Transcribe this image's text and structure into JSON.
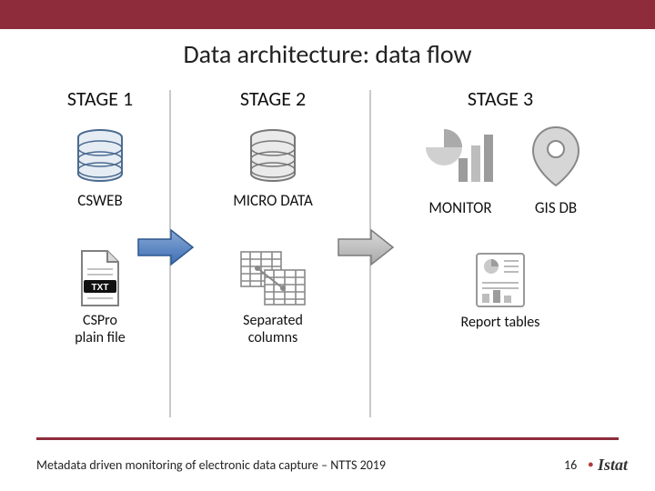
{
  "title": "Data architecture: data flow",
  "stage1": {
    "label": "STAGE 1",
    "db_label": "CSWEB",
    "file_label": "CSPro\nplain file",
    "file_badge": "TXT"
  },
  "stage2": {
    "label": "STAGE 2",
    "db_label": "MICRO DATA",
    "tables_label": "Separated\ncolumns"
  },
  "stage3": {
    "label": "STAGE 3",
    "monitor_label": "MONITOR",
    "gis_label": "GIS DB",
    "report_label": "Report tables"
  },
  "footer": {
    "text": "Metadata driven monitoring of electronic data capture – NTTS 2019",
    "page": "16",
    "brand": "Istat"
  }
}
